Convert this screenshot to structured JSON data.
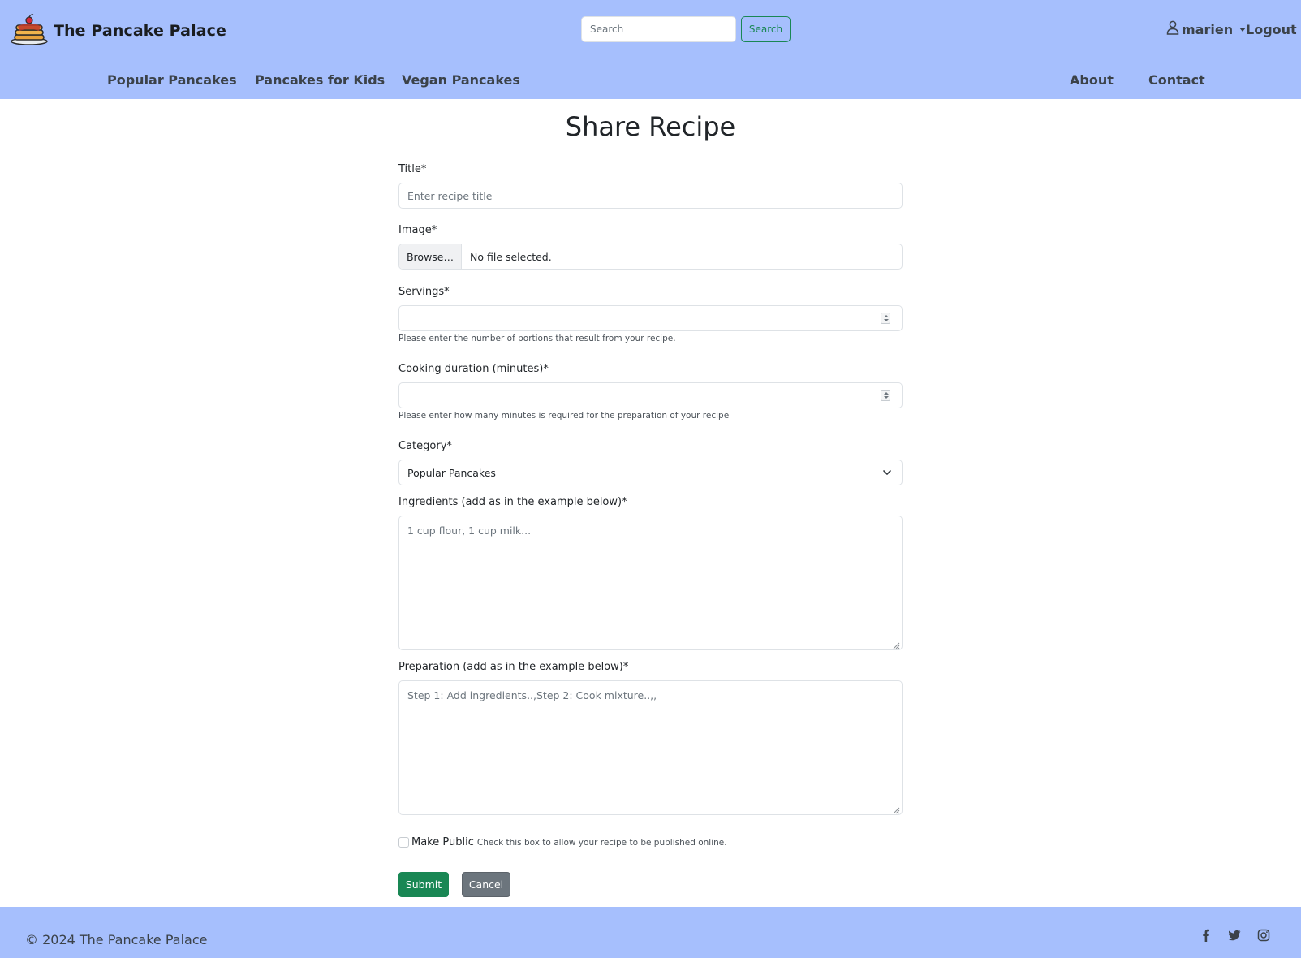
{
  "header": {
    "brand_name": "The Pancake Palace",
    "search": {
      "placeholder": "Search",
      "button_label": "Search"
    },
    "user": {
      "name": "marien"
    },
    "logout_label": "Logout",
    "nav_left": [
      "Popular Pancakes",
      "Pancakes for Kids",
      "Vegan Pancakes"
    ],
    "nav_right": [
      "About",
      "Contact"
    ]
  },
  "main": {
    "title": "Share Recipe",
    "form": {
      "title": {
        "label": "Title*",
        "placeholder": "Enter recipe title"
      },
      "image": {
        "label": "Image*",
        "browse_label": "Browse…",
        "status": "No file selected."
      },
      "servings": {
        "label": "Servings*",
        "value": "",
        "help": "Please enter the number of portions that result from your recipe."
      },
      "duration": {
        "label": "Cooking duration (minutes)*",
        "value": "",
        "help": "Please enter how many minutes is required for the preparation of your recipe"
      },
      "category": {
        "label": "Category*",
        "selected": "Popular Pancakes"
      },
      "ingredients": {
        "label": "Ingredients (add as in the example below)*",
        "placeholder": "1 cup flour, 1 cup milk..."
      },
      "preparation": {
        "label": "Preparation (add as in the example below)*",
        "placeholder": "Step 1: Add ingredients..,Step 2: Cook mixture..,,"
      },
      "make_public": {
        "label": "Make Public",
        "help": "Check this box to allow your recipe to be published online.",
        "checked": false
      },
      "submit_label": "Submit",
      "cancel_label": "Cancel"
    }
  },
  "footer": {
    "copyright": "© 2024 The Pancake Palace",
    "social_icons": [
      "facebook-icon",
      "twitter-icon",
      "instagram-icon"
    ]
  },
  "colors": {
    "header_bg": "#a6bffd",
    "footer_bg": "#a6bffd",
    "accent_green": "#198754",
    "secondary_gray": "#6c757d"
  }
}
